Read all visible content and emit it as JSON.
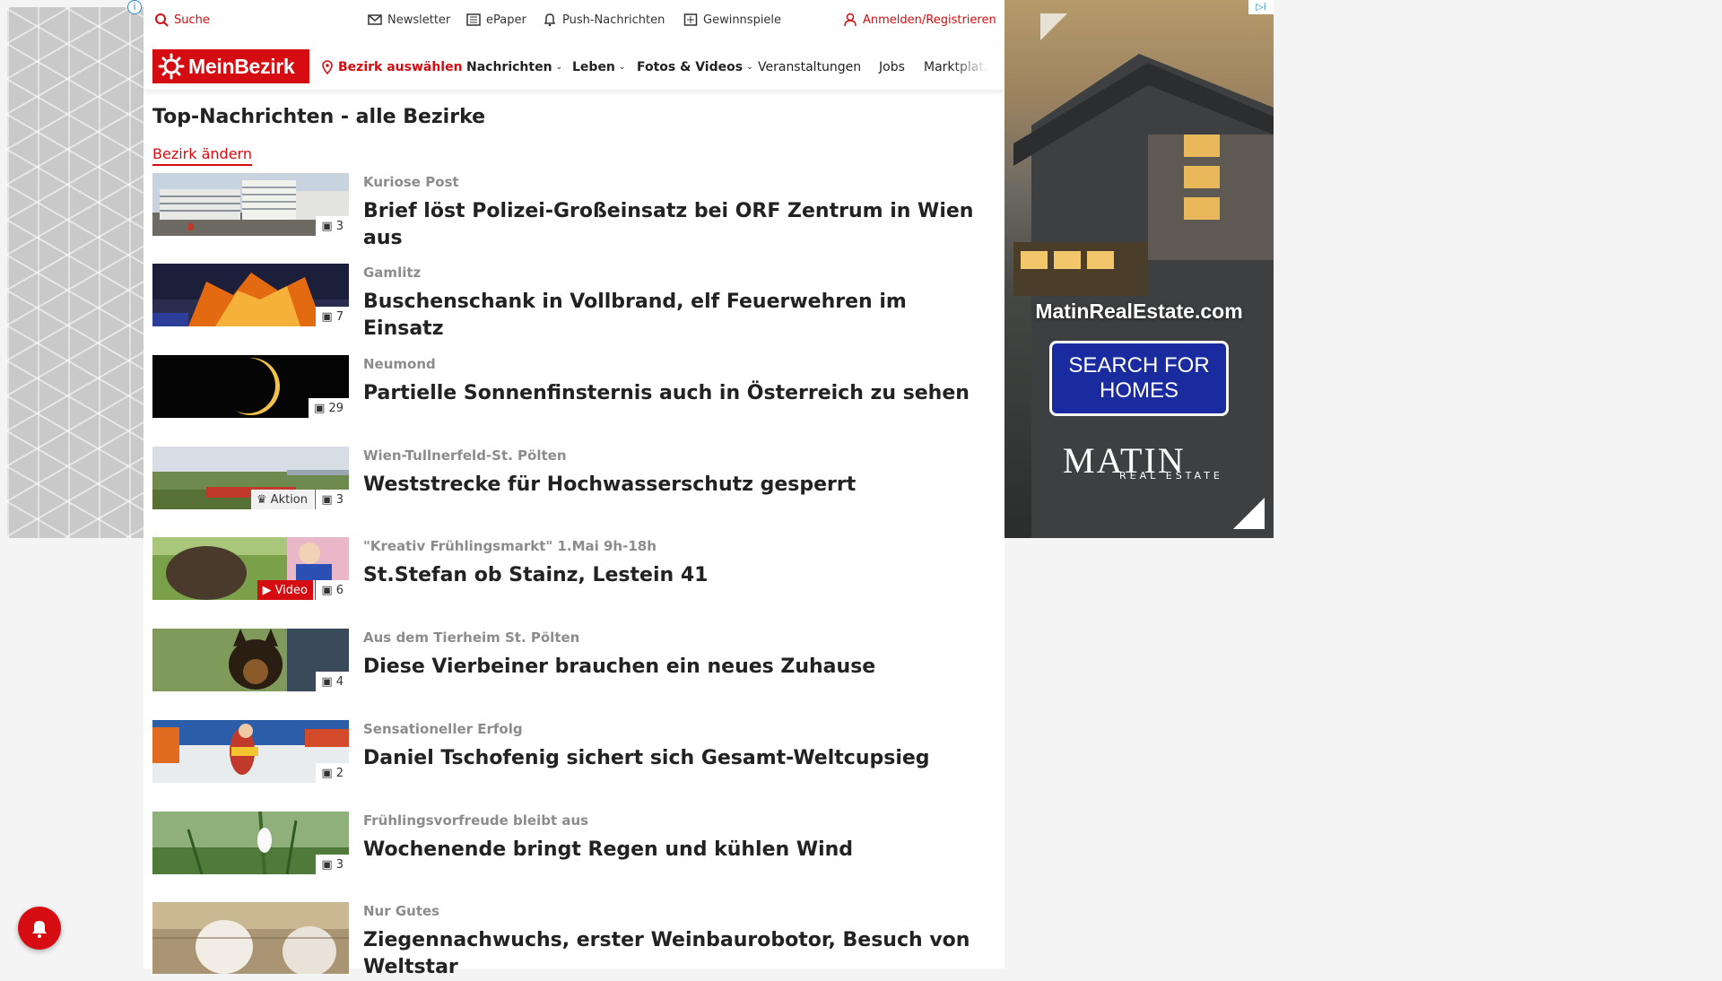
{
  "utility_bar": {
    "search_label": "Suche",
    "newsletter_label": "Newsletter",
    "epaper_label": "ePaper",
    "push_label": "Push-Nachrichten",
    "contest_label": "Gewinnspiele",
    "login_label": "Anmelden/Registrieren"
  },
  "nav": {
    "logo_text": "MeinBezirk",
    "district_select": "Bezirk auswählen",
    "items": [
      {
        "label": "Nachrichten"
      },
      {
        "label": "Leben"
      },
      {
        "label": "Fotos & Videos"
      },
      {
        "label": "Veranstaltungen"
      },
      {
        "label": "Jobs"
      },
      {
        "label": "Marktplatz"
      }
    ]
  },
  "page": {
    "title": "Top-Nachrichten - alle Bezirke",
    "change_district": "Bezirk ändern"
  },
  "articles": [
    {
      "kicker": "Kuriose Post",
      "headline": "Brief löst Polizei-Großeinsatz bei ORF Zentrum in Wien aus",
      "photos": "3",
      "thumb_icon": "building-photo"
    },
    {
      "kicker": "Gamlitz",
      "headline": "Buschenschank in Vollbrand, elf Feuerwehren im Einsatz",
      "photos": "7",
      "thumb_icon": "fire-photo"
    },
    {
      "kicker": "Neumond",
      "headline": "Partielle Sonnenfinsternis auch in Österreich zu sehen",
      "photos": "29",
      "thumb_icon": "eclipse-photo"
    },
    {
      "kicker": "Wien-Tullnerfeld-St. Pölten",
      "headline": "Weststrecke für Hochwasserschutz gesperrt",
      "photos": "3",
      "action_label": "Aktion",
      "thumb_icon": "train-photo"
    },
    {
      "kicker": "\"Kreativ Frühlingsmarkt\" 1.Mai 9h-18h",
      "headline": "St.Stefan ob Stainz, Lestein 41",
      "photos": "6",
      "video_label": "Video",
      "thumb_icon": "alpaca-photo"
    },
    {
      "kicker": "Aus dem Tierheim St. Pölten",
      "headline": "Diese Vierbeiner brauchen ein neues Zuhause",
      "photos": "4",
      "thumb_icon": "dog-photo"
    },
    {
      "kicker": "Sensationeller Erfolg",
      "headline": "Daniel Tschofenig sichert sich Gesamt-Weltcupsieg",
      "photos": "2",
      "thumb_icon": "skijumper-photo"
    },
    {
      "kicker": "Frühlingsvorfreude bleibt aus",
      "headline": "Wochenende bringt Regen und kühlen Wind",
      "photos": "3",
      "thumb_icon": "snowdrop-photo"
    },
    {
      "kicker": "Nur Gutes",
      "headline": "Ziegennachwuchs, erster Weinbaurobotor, Besuch von Weltstar",
      "photos": "",
      "thumb_icon": "goat-photo"
    }
  ],
  "right_ad": {
    "url": "MatinRealEstate.com",
    "button": "SEARCH FOR HOMES",
    "brand": "MATIN",
    "brand_sub": "REAL ESTATE"
  },
  "colors": {
    "brand_red": "#d50d12",
    "ad_button_blue": "#1a2a9f"
  }
}
